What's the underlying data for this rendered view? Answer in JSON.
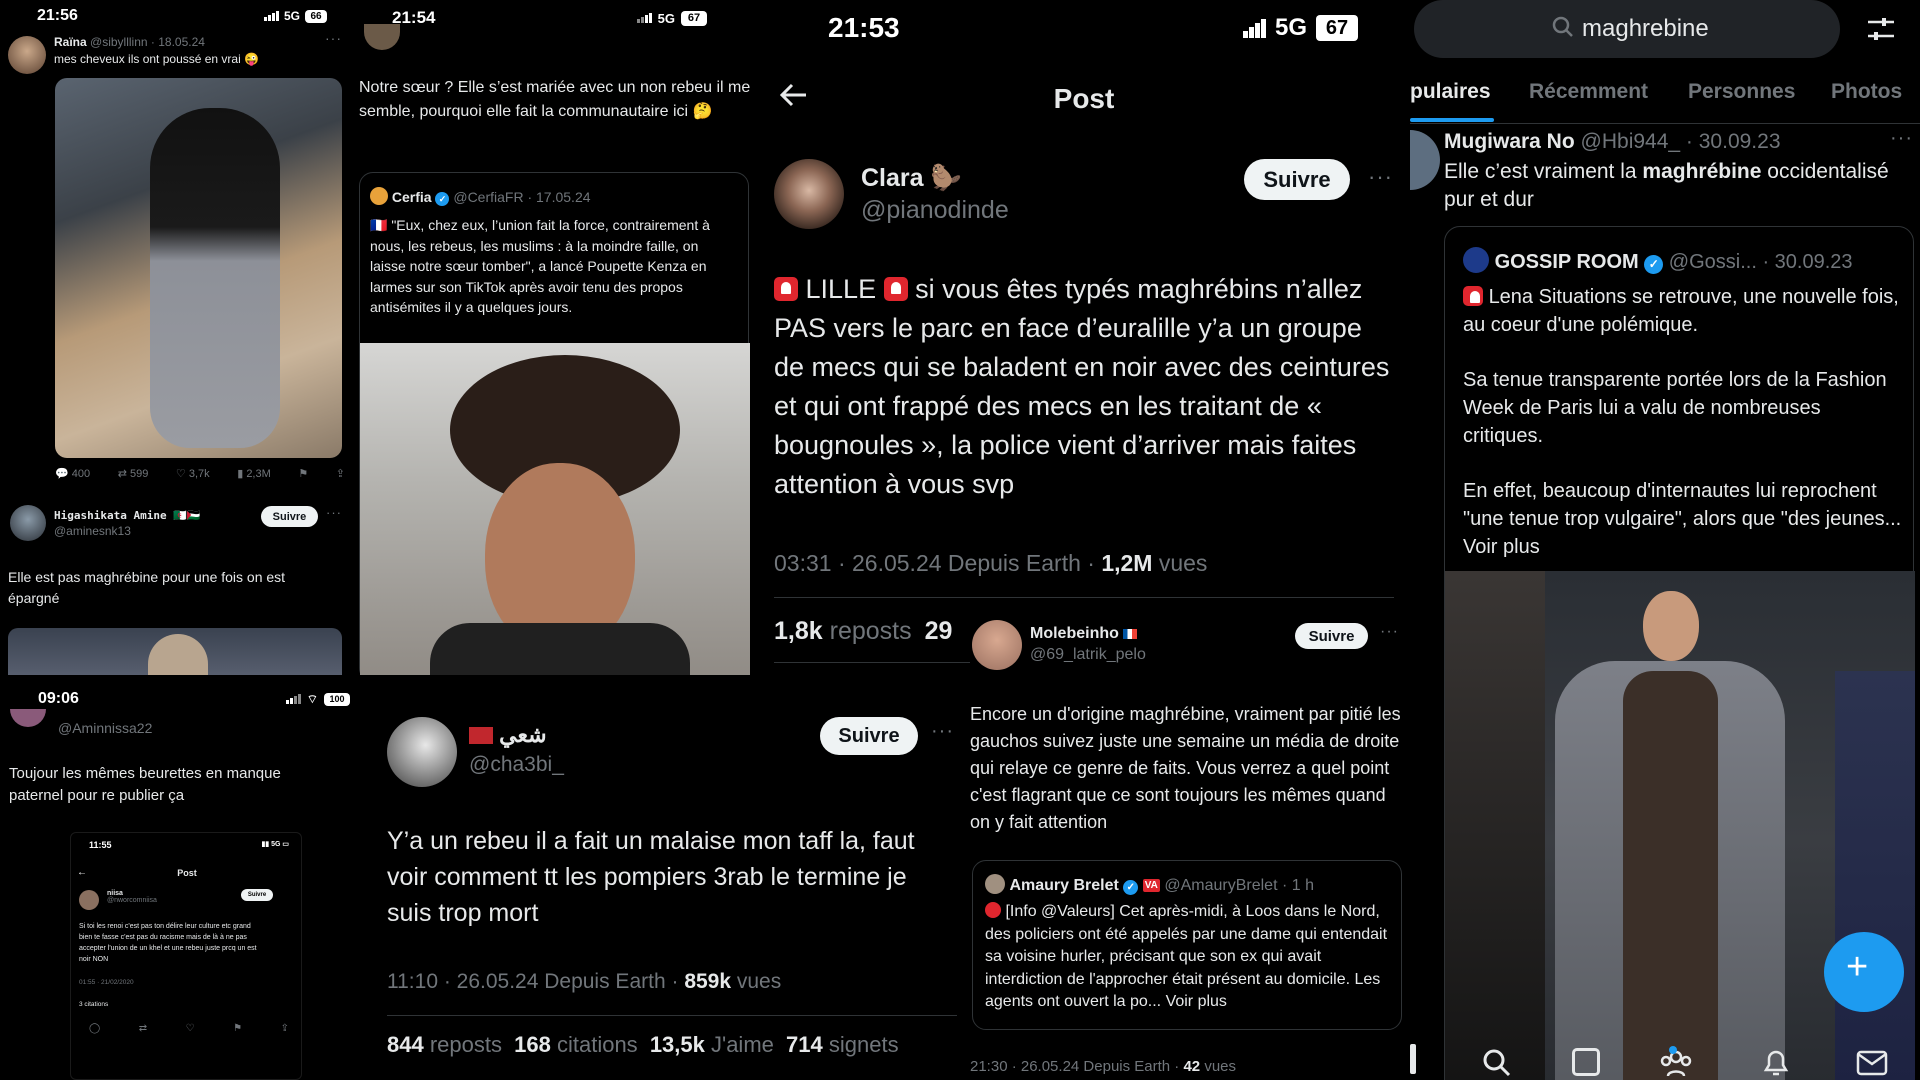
{
  "p1": {
    "time": "21:56",
    "network": "5G",
    "battery": "66",
    "tweet1": {
      "name": "Raïna",
      "handle": "@sibylllinn",
      "date": "· 18.05.24",
      "text": "mes cheveux ils ont poussé en vrai 😜"
    },
    "actions": {
      "replies": "400",
      "reposts": "599",
      "likes": "3,7k",
      "views": "2,3M"
    },
    "reply": {
      "name": "Higashikata Amine 🇩🇿🇵🇸",
      "handle": "@aminesnk13",
      "follow": "Suivre",
      "text": "Elle est pas maghrébine pour une fois on est épargné"
    }
  },
  "p2": {
    "time": "21:54",
    "network": "5G",
    "battery": "67",
    "tweet": {
      "text": "Notre sœur ? Elle s’est mariée avec un non rebeu il me semble, pourquoi elle fait la communautaire ici 🤔"
    },
    "quote": {
      "name": "Cerfia",
      "handle": "@CerfiaFR",
      "date": "· 17.05.24",
      "text": "🇫🇷 \"Eux, chez eux, l’union fait la force, contrairement à nous, les rebeus, les muslims : à la moindre faille, on laisse notre sœur tomber\", a lancé Poupette Kenza en larmes sur son TikTok après avoir tenu des propos antisémites il y a quelques jours."
    }
  },
  "p3": {
    "time": "21:53",
    "network": "5G",
    "battery": "67",
    "title": "Post",
    "user": {
      "name": "Clara 🦫",
      "handle": "@pianodinde",
      "follow": "Suivre"
    },
    "text_city": "LILLE",
    "text": "si vous êtes typés maghrébins n’allez PAS vers le parc en face d’euralille y’a un groupe de mecs qui se baladent en noir avec des ceintures et qui ont frappé des mecs en les traitant de « bougnoules », la police vient d’arriver mais faites attention à vous svp",
    "meta": {
      "datetime": "03:31 · 26.05.24 Depuis Earth ·",
      "views_count": "1,2M",
      "views_label": "vues"
    },
    "stats": {
      "reposts_count": "1,8k",
      "reposts_label": "reposts",
      "extra": "29"
    }
  },
  "p4": {
    "search": "maghrebine",
    "tabs": [
      "pulaires",
      "Récemment",
      "Personnes",
      "Photos"
    ],
    "tweet": {
      "name": "Mugiwara No",
      "handle": "@Hbi944_",
      "date": "· 30.09.23",
      "text_before": "Elle c’est vraiment la ",
      "text_bold": "maghrébine",
      "text_after": " occidentalisé pur et dur"
    },
    "quote": {
      "name": "GOSSIP ROOM",
      "handle": "@Gossi...",
      "date": "· 30.09.23",
      "line1": "Lena Situations se retrouve, une nouvelle fois, au coeur d'une polémique.",
      "line2": "Sa tenue transparente portée lors de la Fashion Week de Paris lui a valu de nombreuses critiques.",
      "line3": "En effet, beaucoup d'internautes lui reprochent \"une tenue trop vulgaire\", alors que \"des jeunes... Voir plus"
    }
  },
  "p5": {
    "time": "09:06",
    "battery": "100",
    "handle": "@Aminnissa22",
    "text": "Toujour les mêmes beurettes en manque paternel pour re publier ça",
    "inner": {
      "time": "11:55",
      "title": "Post",
      "name": "niisa",
      "handle": "@nworcomniisa",
      "follow": "Suivre",
      "text": "Si toi les renoi c'est pas ton délire leur culture etc grand bien te fasse c'est pas du racisme mais de là à ne pas accepter l'union de un khel et une rebeu juste prcq un est noir NON",
      "date": "01:55 · 21/02/2020",
      "citations": "3 citations"
    }
  },
  "p6": {
    "name": "شعي",
    "handle": "@cha3bi_",
    "follow": "Suivre",
    "text": "Y’a un rebeu il a fait un malaise  mon taff la, faut voir comment tt les pompiers 3rab le termine je suis trop mort",
    "meta": {
      "datetime": "11:10 · 26.05.24 Depuis Earth ·",
      "views_count": "859k",
      "views_label": "vues"
    },
    "stats": {
      "reposts": "844",
      "reposts_label": "reposts",
      "citations": "168",
      "citations_label": "citations",
      "likes": "13,5k",
      "likes_label": "J'aime",
      "bookmarks": "714",
      "bookmarks_label": "signets"
    }
  },
  "p7": {
    "name": "Molebeinho",
    "handle": "@69_latrik_pelo",
    "follow": "Suivre",
    "text": "Encore un d'origine maghrébine, vraiment par pitié les gauchos suivez juste une semaine un média de droite qui relaye ce genre de faits. Vous verrez a quel point c'est flagrant que ce sont toujours les mêmes quand on y fait attention",
    "quote": {
      "name": "Amaury Brelet",
      "badge": "VA",
      "handle": "@AmauryBrelet",
      "date": "· 1 h",
      "text": "[Info @Valeurs] Cet après-midi, à Loos dans le Nord, des policiers ont été appelés par une dame qui entendait sa voisine hurler, précisant que son ex qui avait interdiction de l'approcher était présent au domicile. Les agents ont ouvert la po... Voir plus"
    },
    "meta": {
      "datetime": "21:30 · 26.05.24 Depuis Earth ·",
      "views_count": "42",
      "views_label": "vues"
    }
  },
  "icons": [
    "signal-icon",
    "battery-icon",
    "back-arrow-icon",
    "more-icon",
    "search-icon",
    "filter-icon",
    "reply-icon",
    "repost-icon",
    "like-icon",
    "views-icon",
    "bookmark-icon",
    "share-icon",
    "compose-icon",
    "home-icon",
    "notifications-icon",
    "messages-icon",
    "communities-icon",
    "verified-icon"
  ],
  "colors": {
    "background": "#000000",
    "text": "#e7e9ea",
    "muted": "#71767b",
    "accent": "#1d9bf0",
    "follow_bg": "#eff3f4",
    "divider": "#2f3336"
  }
}
